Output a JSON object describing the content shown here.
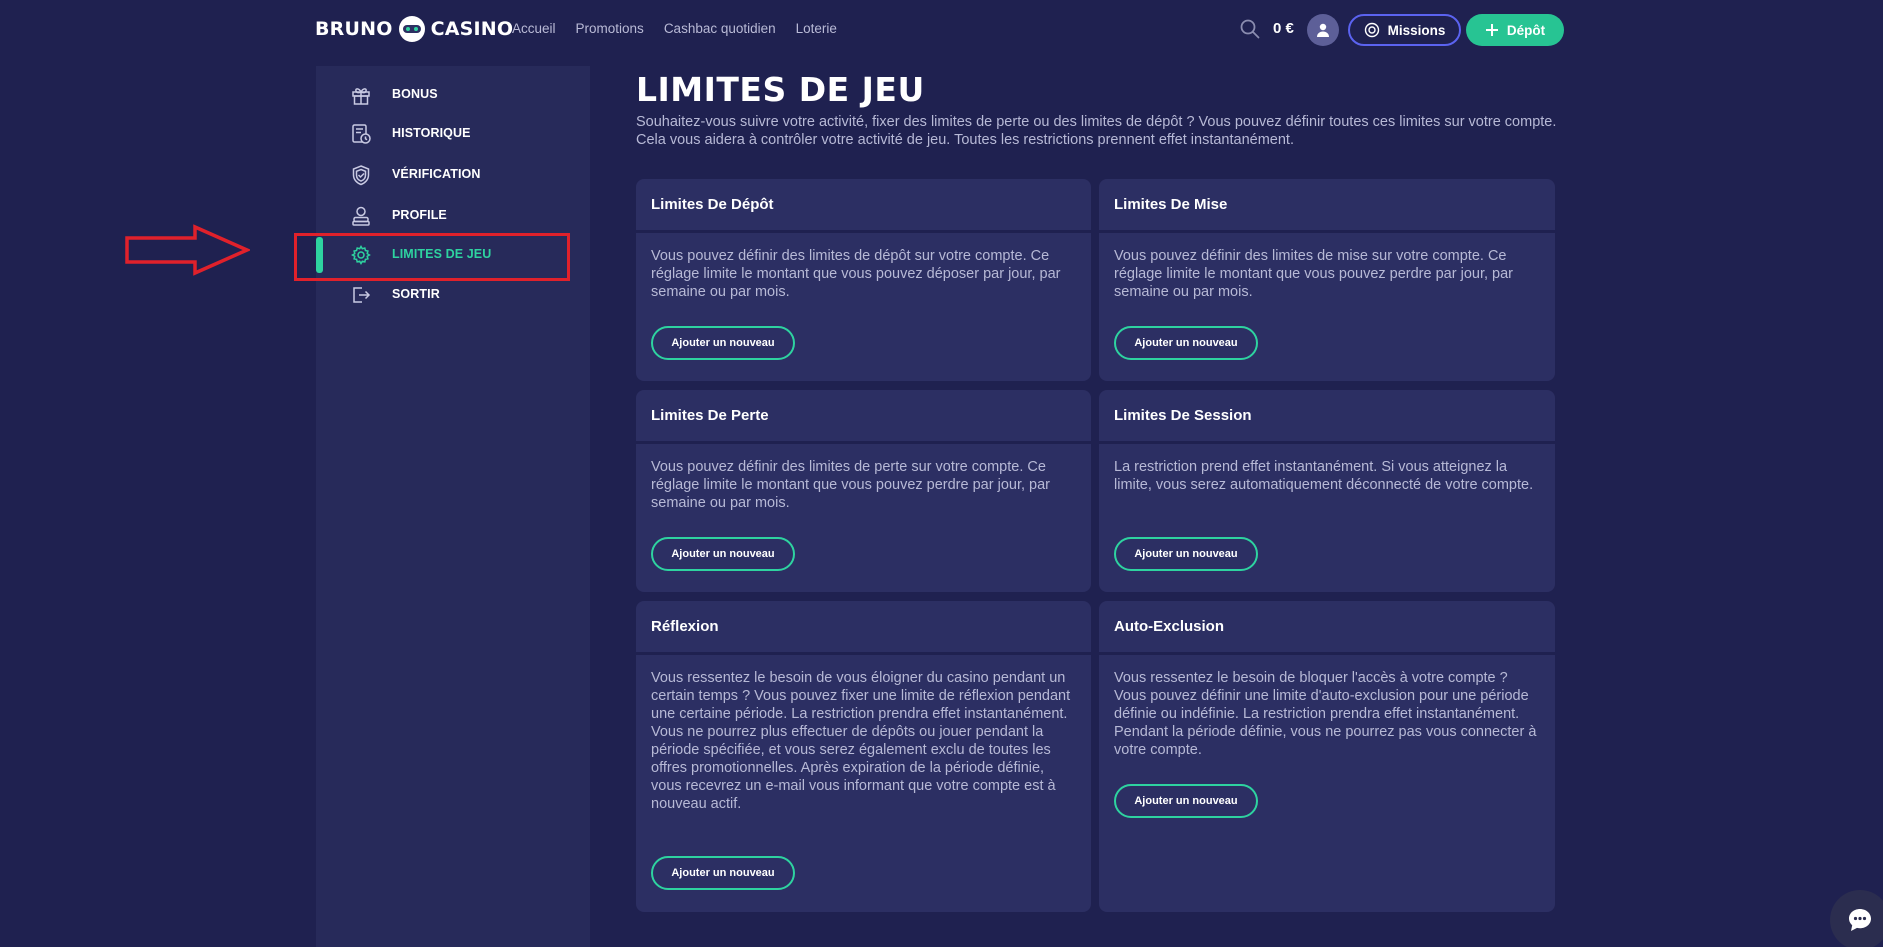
{
  "header": {
    "logo_left": "BRUNO",
    "logo_right": "CASINO",
    "nav": [
      "Accueil",
      "Promotions",
      "Cashbac quotidien",
      "Loterie"
    ],
    "balance": "0 €",
    "missions_label": "Missions",
    "depot_label": "Dépôt",
    "accent_color": "#27c493",
    "missions_border_color": "#5b63f0"
  },
  "sidebar": {
    "items": [
      {
        "label": "BONUS",
        "icon": "gift-icon"
      },
      {
        "label": "HISTORIQUE",
        "icon": "history-icon"
      },
      {
        "label": "VÉRIFICATION",
        "icon": "shield-icon"
      },
      {
        "label": "PROFILE",
        "icon": "user-icon"
      },
      {
        "label": "LIMITES DE JEU",
        "icon": "gear-icon",
        "active": true
      },
      {
        "label": "SORTIR",
        "icon": "logout-icon"
      }
    ]
  },
  "main": {
    "title": "LIMITES DE JEU",
    "description": "Souhaitez-vous suivre votre activité, fixer des limites de perte ou des limites de dépôt ? Vous pouvez définir toutes ces limites sur votre compte. Cela vous aidera à contrôler votre activité de jeu. Toutes les restrictions prennent effet instantanément.",
    "cards": [
      {
        "title": "Limites De Dépôt",
        "text": "Vous pouvez définir des limites de dépôt sur votre compte. Ce réglage limite le montant que vous pouvez déposer par jour, par semaine ou par mois.",
        "button": "Ajouter un nouveau"
      },
      {
        "title": "Limites De Mise",
        "text": "Vous pouvez définir des limites de mise sur votre compte. Ce réglage limite le montant que vous pouvez perdre par jour, par semaine ou par mois.",
        "button": "Ajouter un nouveau"
      },
      {
        "title": "Limites De Perte",
        "text": "Vous pouvez définir des limites de perte sur votre compte. Ce réglage limite le montant que vous pouvez perdre par jour, par semaine ou par mois.",
        "button": "Ajouter un nouveau"
      },
      {
        "title": "Limites De Session",
        "text": "La restriction prend effet instantanément. Si vous atteignez la limite, vous serez automatiquement déconnecté de votre compte.",
        "button": "Ajouter un nouveau"
      },
      {
        "title": "Réflexion",
        "text": "Vous ressentez le besoin de vous éloigner du casino pendant un certain temps ? Vous pouvez fixer une limite de réflexion pendant une certaine période. La restriction prendra effet instantanément. Vous ne pourrez plus effectuer de dépôts ou jouer pendant la période spécifiée, et vous serez également exclu de toutes les offres promotionnelles. Après expiration de la période définie, vous recevrez un e-mail vous informant que votre compte est à nouveau actif.",
        "button": "Ajouter un nouveau"
      },
      {
        "title": "Auto-Exclusion",
        "text": "Vous ressentez le besoin de bloquer l'accès à votre compte ? Vous pouvez définir une limite d'auto-exclusion pour une période définie ou indéfinie. La restriction prendra effet instantanément. Pendant la période définie, vous ne pourrez pas vous connecter à votre compte.",
        "button": "Ajouter un nouveau"
      }
    ]
  },
  "annotation_color": "#e0212b"
}
